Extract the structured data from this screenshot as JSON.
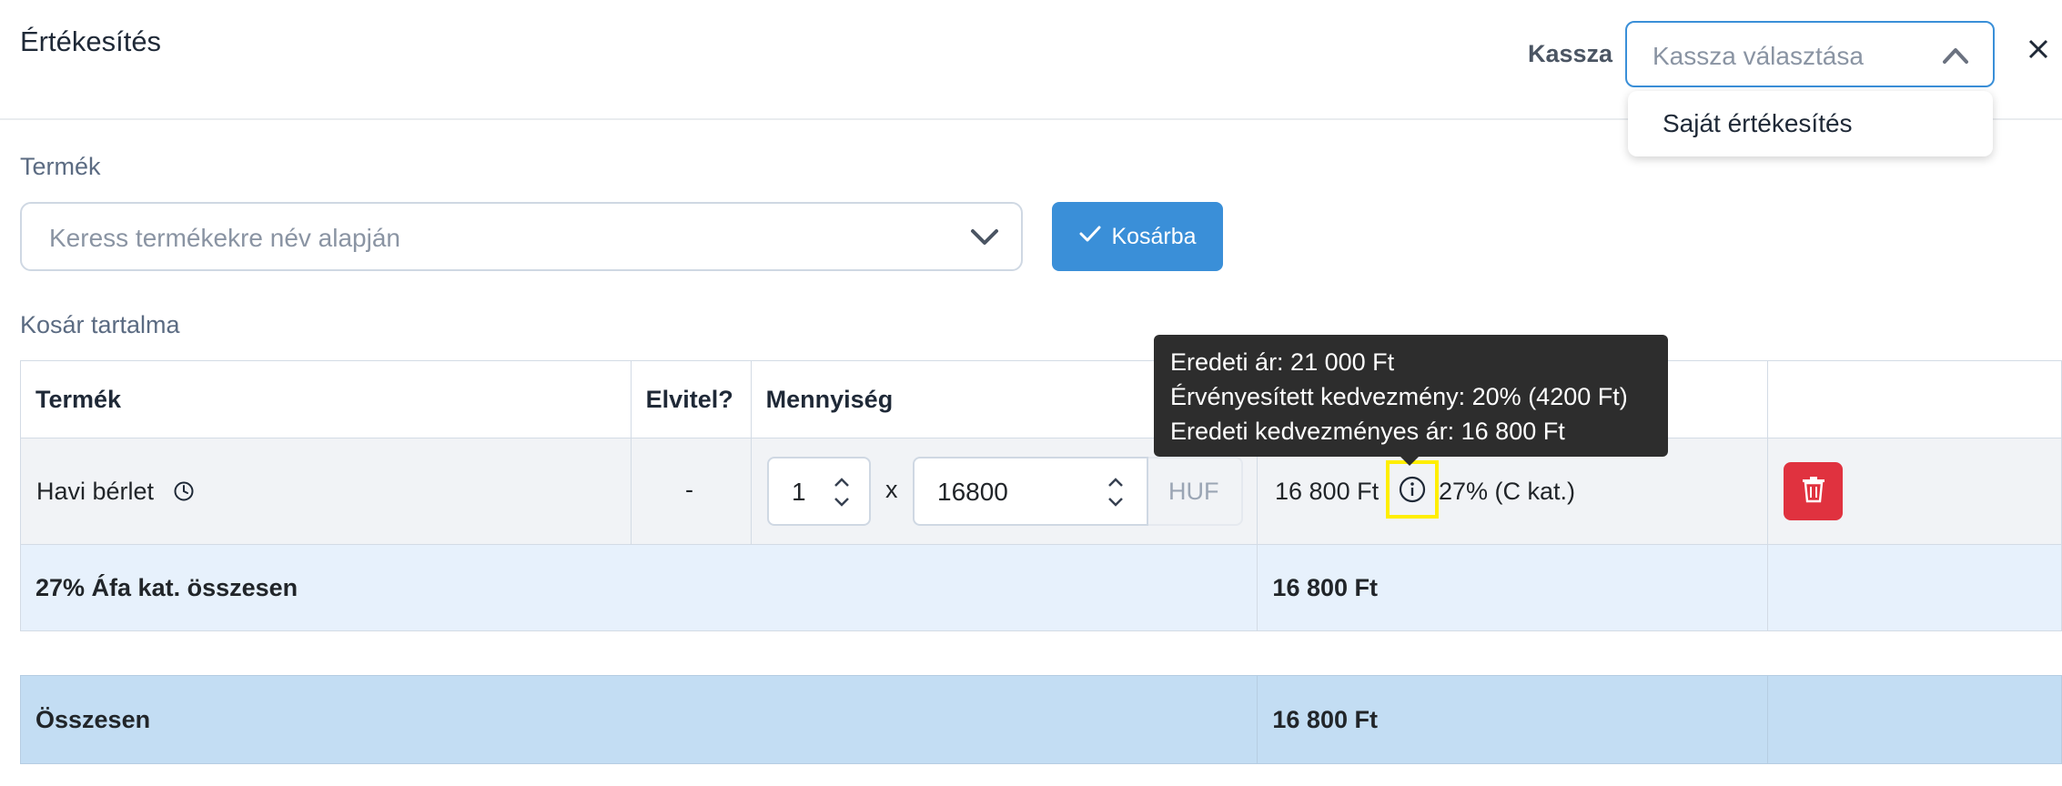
{
  "header": {
    "title": "Értékesítés",
    "kassza_label": "Kassza",
    "kassza_placeholder": "Kassza választása",
    "dropdown_options": [
      "Saját értékesítés"
    ]
  },
  "product": {
    "label": "Termék",
    "search_placeholder": "Keress termékekre név alapján",
    "add_button": "Kosárba"
  },
  "cart": {
    "label": "Kosár tartalma",
    "columns": [
      "Termék",
      "Elvitel?",
      "Mennyiség",
      "",
      ""
    ],
    "rows": [
      {
        "product": "Havi bérlet",
        "takeaway": "-",
        "quantity": "1",
        "multiply": "x",
        "unit_price": "16800",
        "currency": "HUF",
        "total": "16 800 Ft",
        "vat": "27% (C kat.)"
      }
    ],
    "vat_summary_label": "27% Áfa kat. összesen",
    "vat_summary_value": "16 800 Ft",
    "grand_total_label": "Összesen",
    "grand_total_value": "16 800 Ft"
  },
  "tooltip": {
    "lines": [
      "Eredeti ár: 21 000 Ft",
      "Érvényesített kedvezmény: 20% (4200 Ft)",
      "Eredeti kedvezményes ár: 16 800 Ft"
    ]
  },
  "colors": {
    "primary": "#3a8fd8",
    "danger": "#e0323f",
    "highlight": "#ffee00",
    "vat_row": "#e7f1fc",
    "total_row": "#c3ddf3"
  },
  "icons": [
    "chevron-up-icon",
    "close-icon",
    "chevron-down-icon",
    "check-icon",
    "clock-icon",
    "spinner-icon",
    "info-icon",
    "trash-icon"
  ]
}
